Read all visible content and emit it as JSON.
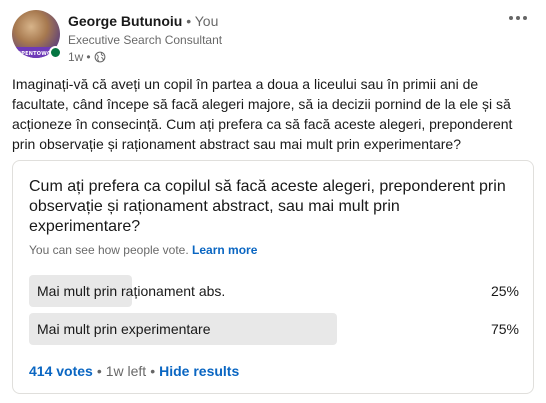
{
  "author": {
    "name": "George Butunoiu",
    "relation": "• You",
    "headline": "Executive Search Consultant",
    "time": "1w",
    "visibility_icon": "globe-icon",
    "avatar_badge": "#OPENTOWORK"
  },
  "post": {
    "text": "Imaginați-vă că aveți un copil în partea a doua a liceului sau în primii ani de facultate, când începe să facă alegeri majore, să ia decizii pornind de la ele și să acționeze în consecință. Cum ați prefera ca să facă aceste alegeri, preponderent prin observație și raționament abstract sau mai mult prin experimentare?"
  },
  "poll": {
    "question": "Cum ați prefera ca copilul să facă aceste alegeri, preponderent prin observație și raționament abstract, sau mai mult prin experimentare?",
    "visibility_text": "You can see how people vote.",
    "learn_more": "Learn more",
    "options": [
      {
        "label": "Mai mult prin raționament abs.",
        "percent_label": "25%",
        "fraction": 0.25
      },
      {
        "label": "Mai mult prin experimentare",
        "percent_label": "75%",
        "fraction": 0.75
      }
    ],
    "votes": "414 votes",
    "separator": "•",
    "time_left": "1w left",
    "hide_results": "Hide results"
  },
  "colors": {
    "accent": "#0a66c2",
    "online": "#057642",
    "bar": "#e8e8e8"
  }
}
